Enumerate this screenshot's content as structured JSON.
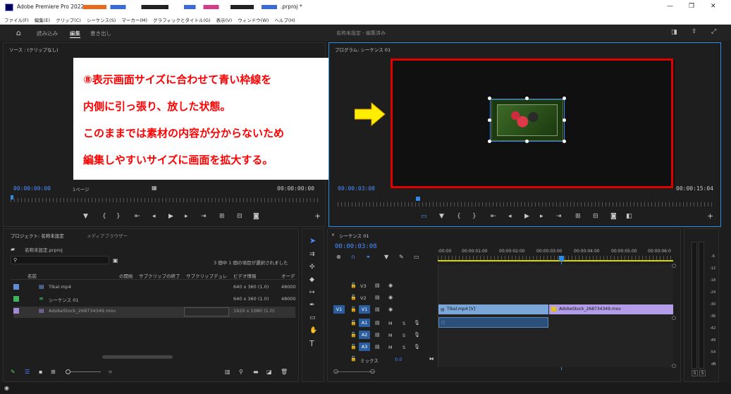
{
  "window": {
    "title": "Adobe Premiere Pro 2022 - ",
    "title_suffix": ".prproj *",
    "controls": {
      "minimize": "—",
      "restore": "❐",
      "close": "✕"
    }
  },
  "menu": [
    "ファイル(F)",
    "編集(E)",
    "クリップ(C)",
    "シーケンス(S)",
    "マーカー(M)",
    "グラフィックとタイトル(G)",
    "表示(V)",
    "ウィンドウ(W)",
    "ヘルプ(H)"
  ],
  "workspace": {
    "tabs": [
      "読み込み",
      "編集",
      "書き出し"
    ],
    "active_tab": "編集",
    "project_name": "名称未設定 - 編集済み"
  },
  "source": {
    "title": "ソース : (クリップなし)",
    "timecode_left": "00:00:00:00",
    "page": "1ページ",
    "timecode_right": "00:00:00:00"
  },
  "program": {
    "title": "プログラム: シーケンス 01",
    "timecode_left": "00:00:03:08",
    "timecode_right": "00:00:15:04"
  },
  "annotation": {
    "lines": [
      "⑧表示画面サイズに合わせて青い枠線を",
      "内側に引っ張り、放した状態。",
      "このままでは素材の内容が分からないため",
      "編集しやすいサイズに画面を拡大する。"
    ]
  },
  "project": {
    "title": "プロジェクト: 名称未設定",
    "tab2": "メディアブラウザー",
    "file": "名称未設定.prproj",
    "selection_info": "3 個中 1 個の項目が選択されました",
    "columns": [
      "名前",
      "の開始",
      "サブクリップの終了",
      "サブクリップデュレ",
      "ビデオ情報",
      "オーデ"
    ],
    "rows": [
      {
        "name": "TIkal.mp4",
        "video": "640 x 360 (1.0)",
        "audio": "48000",
        "color": "#5e8fd6"
      },
      {
        "name": "シーケンス 01",
        "video": "640 x 360 (1.0)",
        "audio": "48000",
        "color": "#3fb35a"
      },
      {
        "name": "AdobeStock_268734349.mov",
        "video": "1920 x 1080 (1.0)",
        "audio": "",
        "color": "#a48ad6"
      }
    ]
  },
  "timeline": {
    "title": "シーケンス 01",
    "timecode": "00:00:03:08",
    "ruler": [
      ":00:00",
      "00:00:01:00",
      "00:00:02:00",
      "00:00:03:00",
      "00:00:04:00",
      "00:00:05:00",
      "00:00:06:0"
    ],
    "video_tracks": [
      "V3",
      "V2",
      "V1"
    ],
    "audio_tracks": [
      "A1",
      "A2",
      "A3"
    ],
    "mix_label": "ミックス",
    "mix_value": "0.0",
    "clip_v1_a": "TIkal.mp4 [V]",
    "clip_v1_b": "AdobeStock_268734349.mov",
    "src_v": "V1",
    "src_a": "A1"
  },
  "meter": {
    "scale": [
      "-6",
      "-12",
      "-18",
      "-24",
      "-30",
      "-36",
      "-42",
      "-48",
      "-54",
      "dB"
    ],
    "buttons": [
      "S",
      "S"
    ]
  },
  "colors": {
    "accent_blue": "#2d8ceb",
    "highlight_red": "#e00000",
    "arrow_yellow": "#ffee00",
    "annotation_text": "#ff0000"
  }
}
